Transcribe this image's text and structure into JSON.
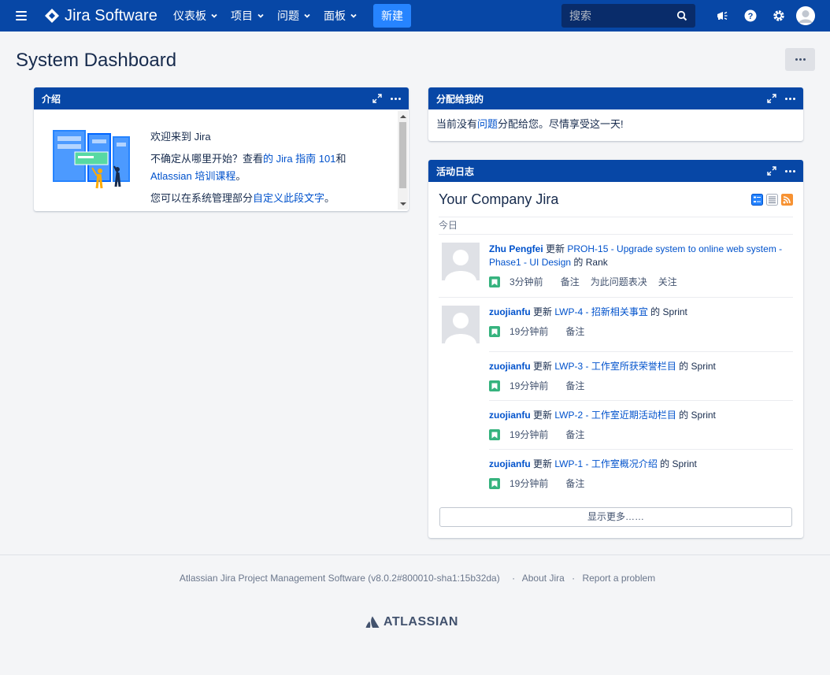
{
  "topnav": {
    "product": "Jira Software",
    "menus": [
      {
        "label": "仪表板"
      },
      {
        "label": "项目"
      },
      {
        "label": "问题"
      },
      {
        "label": "面板"
      }
    ],
    "create_label": "新建",
    "search_placeholder": "搜索",
    "bg_color": "#0747a6"
  },
  "page": {
    "title": "System Dashboard"
  },
  "intro": {
    "header": "介绍",
    "welcome": "欢迎来到 Jira",
    "line2_prefix": "不确定从哪里开始？查看",
    "line2_link": "的 Jira 指南 101",
    "line2_suffix": "和",
    "line3_link": "Atlassian 培训课程",
    "line3_suffix": "。",
    "line4_prefix": "您可以在系统管理部分",
    "line4_link": "自定义此段文字",
    "line4_suffix": "。"
  },
  "assigned": {
    "header": "分配给我的",
    "text_prefix": "当前没有",
    "text_link": "问题",
    "text_suffix": "分配给您。尽情享受这一天!"
  },
  "activity": {
    "header": "活动日志",
    "title": "Your Company Jira",
    "today_label": "今日",
    "updated_word": "更新",
    "of_word": "的",
    "comment_label": "备注",
    "entries": [
      {
        "user": "Zhu Pengfei",
        "issue": "PROH-15 - Upgrade system to online web system - Phase1 - UI Design",
        "field": "Rank",
        "time": "3分钟前",
        "actions": [
          "备注",
          "为此问题表决",
          "关注"
        ]
      },
      {
        "user": "zuojianfu",
        "issue": "LWP-4 - 招新相关事宜",
        "field": "Sprint",
        "time": "19分钟前"
      },
      {
        "user": "zuojianfu",
        "issue": "LWP-3 - 工作室所获荣誉栏目",
        "field": "Sprint",
        "time": "19分钟前"
      },
      {
        "user": "zuojianfu",
        "issue": "LWP-2 - 工作室近期活动栏目",
        "field": "Sprint",
        "time": "19分钟前"
      },
      {
        "user": "zuojianfu",
        "issue": "LWP-1 - 工作室概况介绍",
        "field": "Sprint",
        "time": "19分钟前"
      }
    ],
    "show_more": "显示更多……"
  },
  "footer": {
    "version": "Atlassian Jira Project Management Software (v8.0.2#800010-sha1:15b32da)",
    "about": "About Jira",
    "report": "Report a problem",
    "separator": "·",
    "brand": "ATLASSIAN"
  }
}
